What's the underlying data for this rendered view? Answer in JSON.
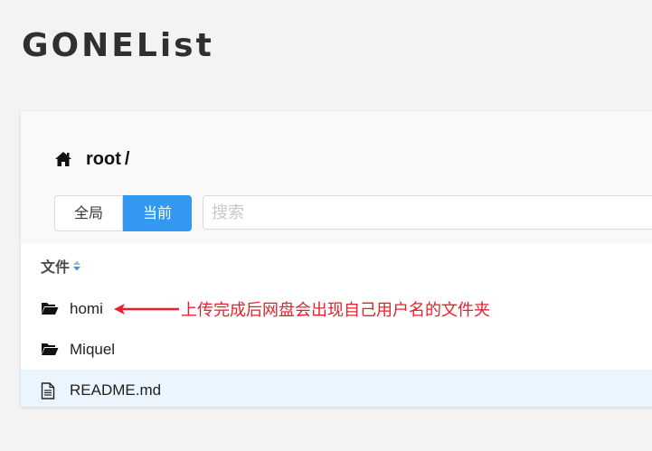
{
  "app": {
    "title": "GONEList"
  },
  "breadcrumb": {
    "root": "root",
    "separator": "/"
  },
  "scope": {
    "options": [
      "全局",
      "当前"
    ],
    "active": "当前"
  },
  "search": {
    "placeholder": "搜索",
    "value": ""
  },
  "table": {
    "header": "文件",
    "rows": [
      {
        "name": "homi",
        "type": "folder",
        "icon": "folder-open-icon"
      },
      {
        "name": "Miquel",
        "type": "folder",
        "icon": "folder-open-icon"
      },
      {
        "name": "README.md",
        "type": "file",
        "icon": "file-text-icon"
      }
    ]
  },
  "annotation": {
    "text": "上传完成后网盘会出现自己用户名的文件夹",
    "color": "#e8202c"
  },
  "colors": {
    "accent": "#3298f0",
    "highlight_row": "#eaf5fd",
    "background": "#f3f3f4"
  }
}
